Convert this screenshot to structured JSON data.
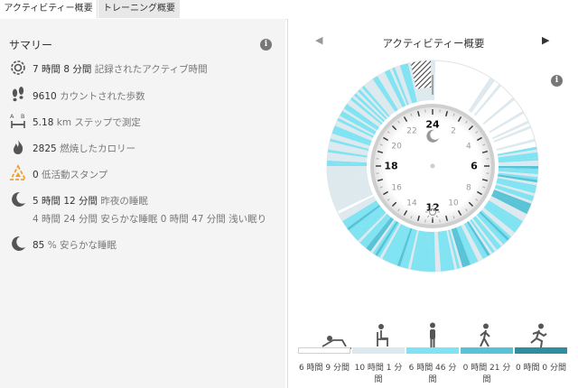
{
  "tabs": [
    {
      "label": "アクティビティー概要",
      "active": true
    },
    {
      "label": "トレーニング概要",
      "active": false
    }
  ],
  "summary": {
    "title": "サマリー",
    "rows": [
      {
        "icon": "active-time-icon",
        "value": "7 時間 8 分間",
        "label": "記録されたアクティブ時間"
      },
      {
        "icon": "footprints-icon",
        "value": "9610",
        "label": "カウントされた歩数"
      },
      {
        "icon": "distance-icon",
        "value": "5.18",
        "unit": "km",
        "label": "ステップで測定"
      },
      {
        "icon": "flame-icon",
        "value": "2825",
        "label": "燃焼したカロリー"
      },
      {
        "icon": "stamp-icon",
        "value": "0",
        "label": "低活動スタンプ"
      },
      {
        "icon": "moon-icon",
        "value": "5 時間 12 分間",
        "label": "昨夜の睡眠"
      },
      {
        "icon": "moon-icon",
        "value": "85",
        "unit": "%",
        "label": "安らかな睡眠"
      }
    ],
    "sleep_detail": "4 時間 24 分間 安らかな睡眠 0 時間 47 分間 浅い眠り"
  },
  "overview": {
    "title": "アクティビティー概要",
    "clock_labels": [
      "24",
      "2",
      "4",
      "6",
      "8",
      "10",
      "12",
      "14",
      "16",
      "18",
      "20",
      "22"
    ],
    "colors": {
      "rest": "#ffffff",
      "sitting": "#dde9ee",
      "low": "#7fe3f2",
      "medium": "#58c3d6",
      "high": "#2f8e9e",
      "hatch": "#444444",
      "ring_shadow": "#cfcfcf"
    },
    "legend": [
      {
        "icon": "lying-icon",
        "label": "6 時間 9 分間",
        "color": "#ffffff"
      },
      {
        "icon": "sitting-icon",
        "label": "10 時間 1 分間",
        "color": "#dde9ee"
      },
      {
        "icon": "standing-icon",
        "label": "6 時間 46 分間",
        "color": "#7fe3f2"
      },
      {
        "icon": "walking-icon",
        "label": "0 時間 21 分間",
        "color": "#58c3d6"
      },
      {
        "icon": "running-icon",
        "label": "0 時間 0 分間",
        "color": "#2f8e9e"
      }
    ]
  }
}
